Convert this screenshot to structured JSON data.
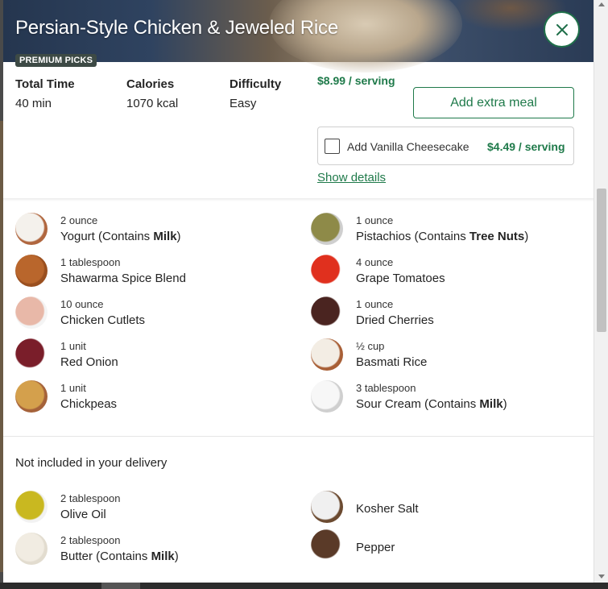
{
  "recipe": {
    "title": "Persian-Style Chicken & Jeweled Rice",
    "badge": "PREMIUM PICKS",
    "stats": [
      {
        "label": "Total Time",
        "value": "40 min"
      },
      {
        "label": "Calories",
        "value": "1070 kcal"
      },
      {
        "label": "Difficulty",
        "value": "Easy"
      }
    ],
    "price": "$8.99 / serving",
    "add_meal_label": "Add extra meal",
    "addon": {
      "label": "Add Vanilla Cheesecake",
      "price": "$4.49 / serving",
      "checked": false
    },
    "details_link": "Show details"
  },
  "ingredients": [
    {
      "qty": "2 ounce",
      "name": "Yogurt (Contains ",
      "allergen": "Milk",
      "suffix": ")",
      "icon": "yogurt-icon",
      "color": "#f4f1ec",
      "rim": "#b0663e"
    },
    {
      "qty": "1 ounce",
      "name": "Pistachios (Contains ",
      "allergen": "Tree Nuts",
      "suffix": ")",
      "icon": "pistachio-icon",
      "color": "#8e8a48",
      "rim": "#cfcfcf"
    },
    {
      "qty": "1 tablespoon",
      "name": "Shawarma Spice Blend",
      "allergen": "",
      "suffix": "",
      "icon": "spice-blend-icon",
      "color": "#b9662c",
      "rim": "#9a4f1f"
    },
    {
      "qty": "4 ounce",
      "name": "Grape Tomatoes",
      "allergen": "",
      "suffix": "",
      "icon": "tomato-icon",
      "color": "#e0301e",
      "rim": "#ffffff"
    },
    {
      "qty": "10 ounce",
      "name": "Chicken Cutlets",
      "allergen": "",
      "suffix": "",
      "icon": "chicken-icon",
      "color": "#e8b8a8",
      "rim": "#f4f4f4"
    },
    {
      "qty": "1 ounce",
      "name": "Dried Cherries",
      "allergen": "",
      "suffix": "",
      "icon": "cherries-icon",
      "color": "#4a2420",
      "rim": "#ffffff"
    },
    {
      "qty": "1 unit",
      "name": "Red Onion",
      "allergen": "",
      "suffix": "",
      "icon": "onion-icon",
      "color": "#7a1e2a",
      "rim": "#ffffff"
    },
    {
      "qty": "½ cup",
      "name": "Basmati Rice",
      "allergen": "",
      "suffix": "",
      "icon": "rice-icon",
      "color": "#f3ede4",
      "rim": "#a85f36"
    },
    {
      "qty": "1 unit",
      "name": "Chickpeas",
      "allergen": "",
      "suffix": "",
      "icon": "chickpea-icon",
      "color": "#d4a04c",
      "rim": "#a5623a"
    },
    {
      "qty": "3 tablespoon",
      "name": "Sour Cream (Contains ",
      "allergen": "Milk",
      "suffix": ")",
      "icon": "sour-cream-icon",
      "color": "#f7f7f7",
      "rim": "#cfcfcf"
    }
  ],
  "pantry": {
    "title": "Not included in your delivery",
    "items": [
      {
        "qty": "2 tablespoon",
        "name": "Olive Oil",
        "allergen": "",
        "suffix": "",
        "icon": "olive-oil-icon",
        "color": "#c9b820",
        "rim": "#f2f2f2"
      },
      {
        "qty": "",
        "name": "Kosher Salt",
        "allergen": "",
        "suffix": "",
        "icon": "salt-icon",
        "color": "#f0f0f0",
        "rim": "#6b4a30"
      },
      {
        "qty": "2 tablespoon",
        "name": "Butter (Contains ",
        "allergen": "Milk",
        "suffix": ")",
        "icon": "butter-icon",
        "color": "#f1ece2",
        "rim": "#e2dccf"
      },
      {
        "qty": "",
        "name": "Pepper",
        "allergen": "",
        "suffix": "",
        "icon": "pepper-icon",
        "color": "#5a3a28",
        "rim": "#ffffff"
      }
    ]
  },
  "colors": {
    "accent": "#1f7a4a",
    "badge": "#3d4a45",
    "text": "#242424"
  }
}
